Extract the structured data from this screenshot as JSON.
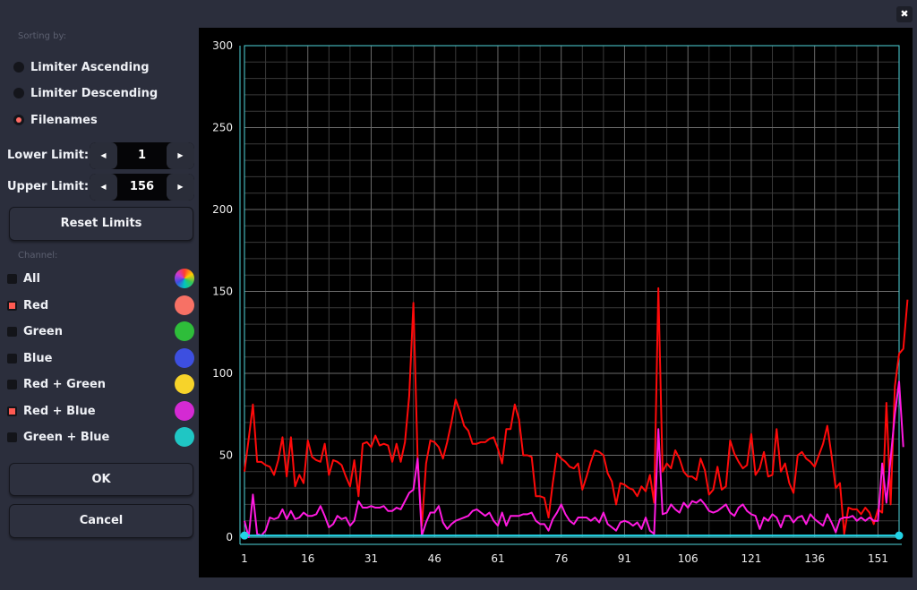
{
  "window": {
    "close_glyph": "✖"
  },
  "sorting": {
    "label": "Sorting by:",
    "options": [
      {
        "label": "Limiter Ascending",
        "selected": false
      },
      {
        "label": "Limiter Descending",
        "selected": false
      },
      {
        "label": "Filenames",
        "selected": true
      }
    ]
  },
  "limits": {
    "lower_label": "Lower Limit:",
    "lower_value": "1",
    "upper_label": "Upper Limit:",
    "upper_value": "156",
    "decrement_glyph": "◀",
    "increment_glyph": "▶"
  },
  "reset_label": "Reset Limits",
  "channel": {
    "label": "Channel:",
    "items": [
      {
        "label": "All",
        "checked": false,
        "color": "conic"
      },
      {
        "label": "Red",
        "checked": true,
        "color": "#f77165"
      },
      {
        "label": "Green",
        "checked": false,
        "color": "#2ebd3a"
      },
      {
        "label": "Blue",
        "checked": false,
        "color": "#3d4fe0"
      },
      {
        "label": "Red + Green",
        "checked": false,
        "color": "#f7d32a"
      },
      {
        "label": "Red + Blue",
        "checked": true,
        "color": "#d42ad3"
      },
      {
        "label": "Green + Blue",
        "checked": false,
        "color": "#1fc6c4"
      }
    ]
  },
  "ok_label": "OK",
  "cancel_label": "Cancel",
  "chart_data": {
    "type": "line",
    "title": "",
    "xlabel": "",
    "ylabel": "",
    "xlim": [
      1,
      156
    ],
    "ylim": [
      0,
      300
    ],
    "x_ticks": [
      1,
      16,
      31,
      46,
      61,
      76,
      91,
      106,
      121,
      136,
      151
    ],
    "y_ticks": [
      0,
      50,
      100,
      150,
      200,
      250,
      300
    ],
    "grid": true,
    "limit_line": {
      "value": 1,
      "from": 1,
      "to": 156,
      "color": "#22d3e6"
    },
    "series": [
      {
        "color": "#ff0a0a",
        "values": [
          40,
          60,
          81,
          46,
          46,
          44,
          43,
          38,
          47,
          61,
          37,
          61,
          31,
          38,
          33,
          59,
          49,
          47,
          46,
          57,
          38,
          47,
          46,
          44,
          37,
          31,
          47,
          25,
          57,
          58,
          55,
          62,
          56,
          57,
          56,
          46,
          57,
          46,
          58,
          86,
          143,
          48,
          7,
          45,
          59,
          58,
          55,
          48,
          58,
          70,
          84,
          77,
          68,
          65,
          57,
          57,
          58,
          58,
          60,
          61,
          54,
          45,
          66,
          66,
          81,
          72,
          50,
          50,
          49,
          25,
          25,
          24,
          12,
          33,
          51,
          48,
          46,
          43,
          42,
          45,
          29,
          37,
          46,
          53,
          52,
          50,
          39,
          34,
          20,
          33,
          32,
          30,
          29,
          25,
          31,
          28,
          38,
          21,
          152,
          40,
          45,
          42,
          53,
          48,
          40,
          37,
          37,
          35,
          48,
          41,
          26,
          29,
          43,
          29,
          31,
          59,
          51,
          46,
          42,
          44,
          63,
          38,
          42,
          52,
          37,
          38,
          66,
          40,
          45,
          33,
          27,
          50,
          52,
          48,
          46,
          43,
          50,
          57,
          68,
          50,
          30,
          33,
          2,
          18,
          17,
          17,
          14,
          18,
          15,
          8,
          17,
          15,
          82,
          20,
          92,
          112,
          115,
          145
        ]
      },
      {
        "color": "#ff1ae0",
        "values": [
          10,
          0,
          26,
          2,
          1,
          4,
          12,
          11,
          12,
          17,
          11,
          16,
          11,
          12,
          15,
          13,
          13,
          14,
          19,
          13,
          6,
          8,
          13,
          11,
          12,
          7,
          10,
          22,
          18,
          18,
          19,
          18,
          18,
          19,
          16,
          16,
          18,
          17,
          22,
          27,
          29,
          48,
          1,
          9,
          15,
          15,
          19,
          9,
          5,
          8,
          10,
          11,
          12,
          13,
          16,
          17,
          15,
          13,
          15,
          10,
          7,
          15,
          7,
          13,
          13,
          13,
          14,
          14,
          15,
          10,
          8,
          8,
          4,
          11,
          15,
          20,
          14,
          10,
          8,
          12,
          12,
          12,
          10,
          12,
          9,
          15,
          8,
          6,
          4,
          9,
          10,
          9,
          7,
          9,
          5,
          12,
          4,
          2,
          66,
          14,
          15,
          20,
          17,
          15,
          21,
          18,
          22,
          21,
          23,
          20,
          16,
          15,
          16,
          18,
          20,
          15,
          13,
          18,
          20,
          16,
          14,
          13,
          5,
          12,
          10,
          14,
          12,
          6,
          13,
          13,
          9,
          12,
          13,
          8,
          14,
          11,
          9,
          7,
          14,
          9,
          3,
          11,
          12,
          12,
          13,
          10,
          12,
          10,
          12,
          10,
          10,
          45,
          21,
          48,
          75,
          95,
          55
        ]
      }
    ]
  }
}
